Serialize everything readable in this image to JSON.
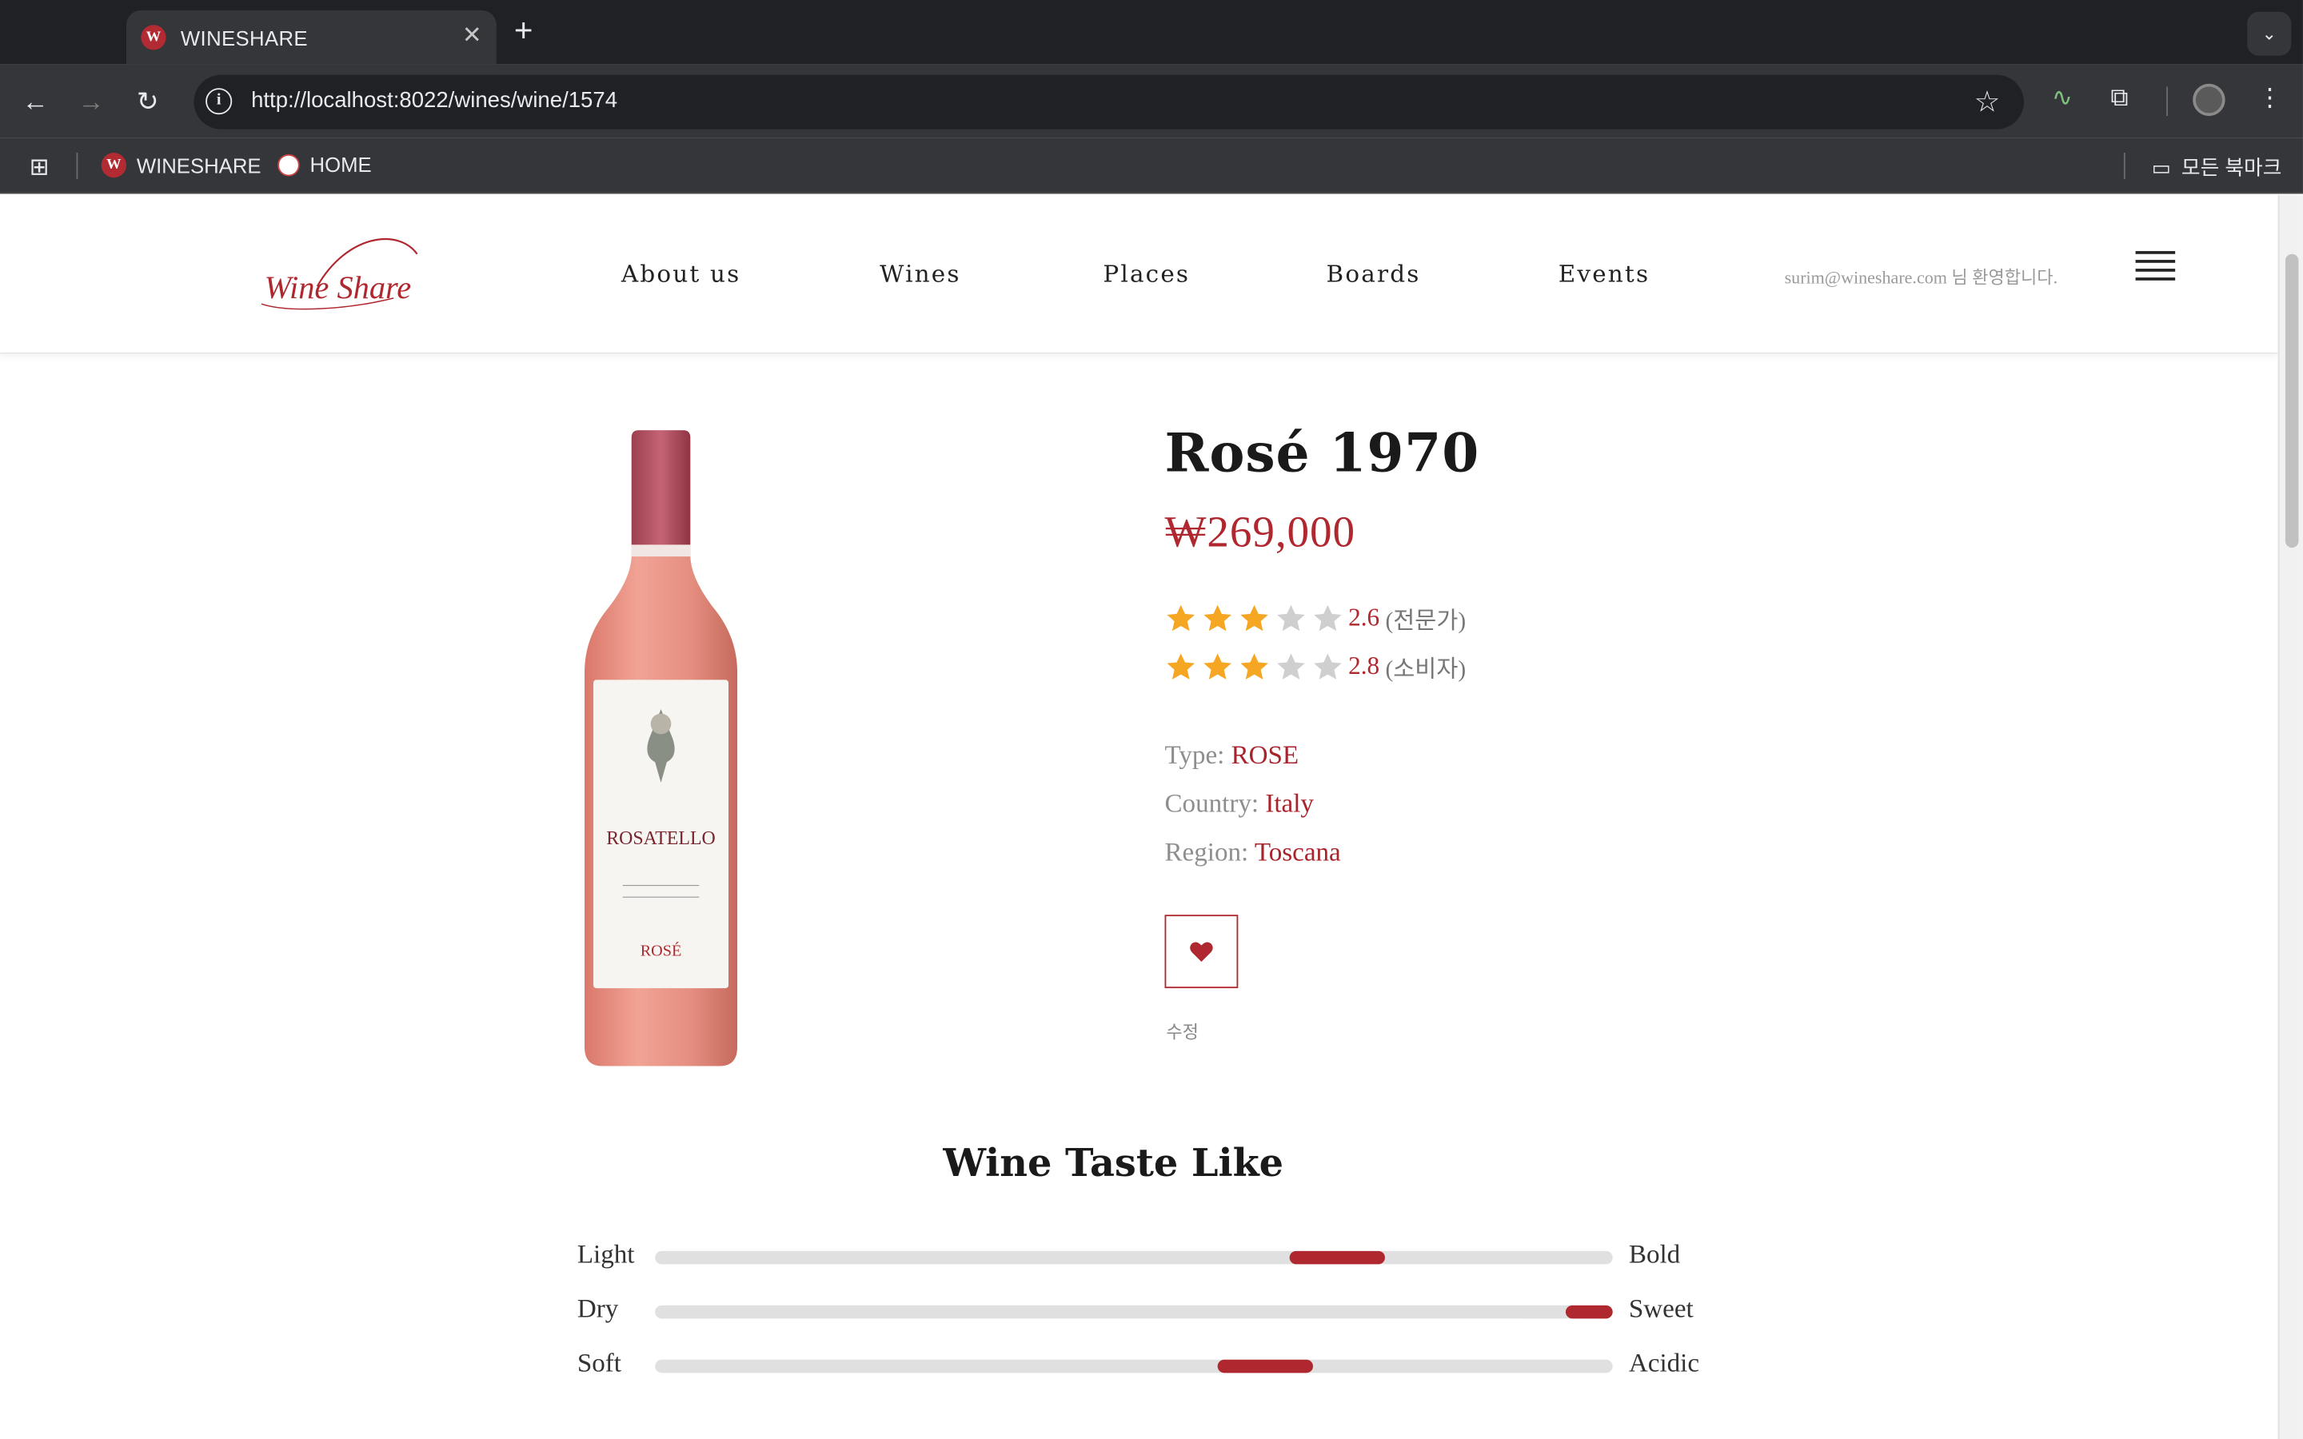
{
  "browser": {
    "tab_title": "WINESHARE",
    "favicon_letter": "W",
    "url": "http://localhost:8022/wines/wine/1574",
    "bookmarks": [
      {
        "label": "WINESHARE"
      },
      {
        "label": "HOME"
      }
    ],
    "all_bookmarks": "모든 북마크"
  },
  "site": {
    "logo_text": "Wine Share",
    "nav": [
      "About us",
      "Wines",
      "Places",
      "Boards",
      "Events"
    ],
    "greeting": "surim@wineshare.com 님 환영합니다."
  },
  "product": {
    "name": "Rosé 1970",
    "price": "₩269,000",
    "ratings": [
      {
        "value": "2.6",
        "kind": "(전문가)",
        "stars_filled": 3,
        "stars_total": 5
      },
      {
        "value": "2.8",
        "kind": "(소비자)",
        "stars_filled": 3,
        "stars_total": 5
      }
    ],
    "info": [
      {
        "label": "Type:",
        "value": "ROSE"
      },
      {
        "label": "Country:",
        "value": "Italy"
      },
      {
        "label": "Region:",
        "value": "Toscana"
      }
    ],
    "edit_label": "수정",
    "label_brand": "ROSATELLO",
    "label_sub": "ROSÉ"
  },
  "taste": {
    "title": "Wine Taste Like",
    "rows": [
      {
        "left": "Light",
        "right": "Bold",
        "start": 0.663,
        "end": 0.762
      },
      {
        "left": "Dry",
        "right": "Sweet",
        "start": 0.951,
        "end": 1.0
      },
      {
        "left": "Soft",
        "right": "Acidic",
        "start": 0.588,
        "end": 0.687
      }
    ]
  },
  "colors": {
    "accent": "#b0282f",
    "star_filled": "#f5a623",
    "star_empty": "#cfcfcf"
  }
}
